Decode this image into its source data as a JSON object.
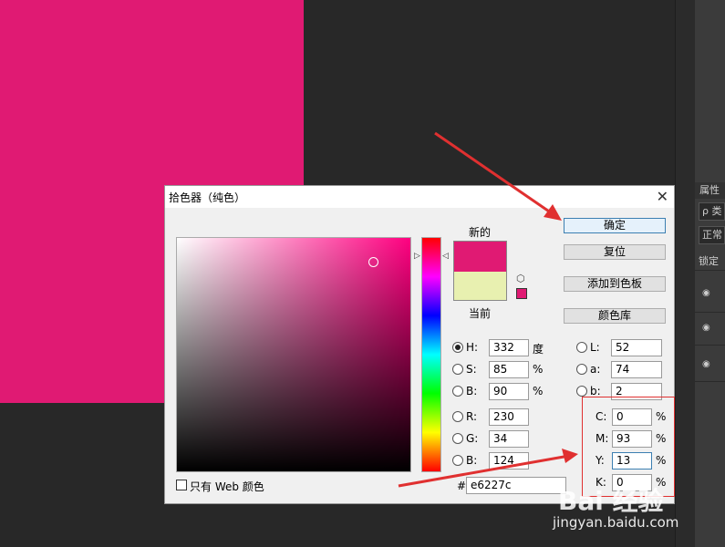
{
  "ps_panel": {
    "tab_label": "属性",
    "search_placeholder": "ρ 类",
    "blend_mode": "正常",
    "lock_label": "锁定"
  },
  "dialog": {
    "title": "拾色器（纯色）",
    "close_glyph": "✕",
    "label_new": "新的",
    "label_current": "当前",
    "new_color": "#e01a73",
    "current_color": "#e8f0b0",
    "buttons": {
      "ok": "确定",
      "reset": "复位",
      "add_to_swatches": "添加到色板",
      "color_libraries": "颜色库"
    },
    "hsb": {
      "h_label": "H:",
      "h_value": "332",
      "h_unit": "度",
      "s_label": "S:",
      "s_value": "85",
      "s_unit": "%",
      "b_label": "B:",
      "b_value": "90",
      "b_unit": "%"
    },
    "rgb": {
      "r_label": "R:",
      "r_value": "230",
      "g_label": "G:",
      "g_value": "34",
      "b_label": "B:",
      "b_value": "124"
    },
    "lab": {
      "l_label": "L:",
      "l_value": "52",
      "a_label": "a:",
      "a_value": "74",
      "b_label": "b:",
      "b_value": "2"
    },
    "cmyk": {
      "c_label": "C:",
      "c_value": "0",
      "c_unit": "%",
      "m_label": "M:",
      "m_value": "93",
      "m_unit": "%",
      "y_label": "Y:",
      "y_value": "13",
      "y_unit": "%",
      "k_label": "K:",
      "k_value": "0",
      "k_unit": "%"
    },
    "web_only_label": "只有 Web 颜色",
    "hash_symbol": "#",
    "hex_value": "e6227c"
  },
  "watermark": {
    "logo_text": "Bai 经验",
    "url": "jingyan.baidu.com"
  },
  "colors": {
    "accent_magenta": "#e01a73",
    "annotation_red": "#e03030"
  }
}
